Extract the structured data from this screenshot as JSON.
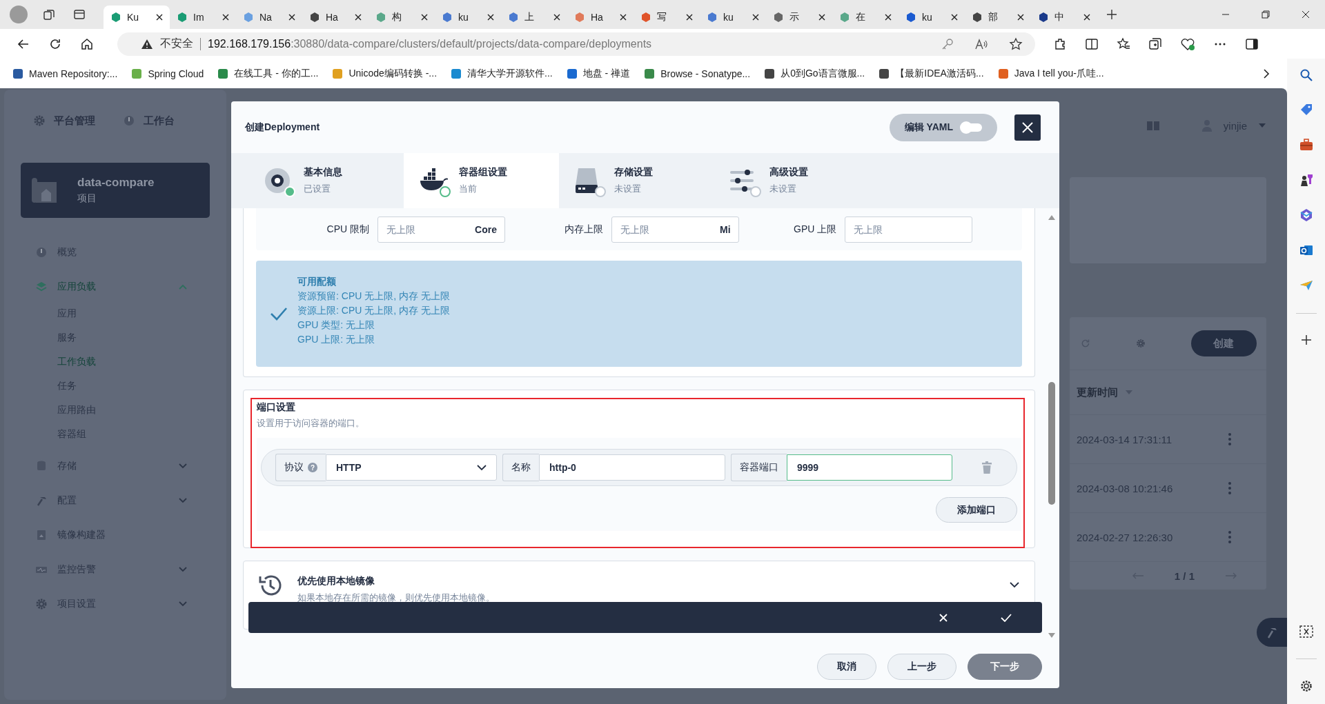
{
  "browser": {
    "tabs": [
      {
        "label": "Ku",
        "selected": true
      },
      {
        "label": "Im",
        "selected": false
      },
      {
        "label": "Na",
        "selected": false
      },
      {
        "label": "Ha",
        "selected": false
      },
      {
        "label": "构",
        "selected": false
      },
      {
        "label": "ku",
        "selected": false
      },
      {
        "label": "上",
        "selected": false
      },
      {
        "label": "Ha",
        "selected": false
      },
      {
        "label": "写",
        "selected": false
      },
      {
        "label": "ku",
        "selected": false
      },
      {
        "label": "示",
        "selected": false
      },
      {
        "label": "在",
        "selected": false
      },
      {
        "label": "ku",
        "selected": false
      },
      {
        "label": "部",
        "selected": false
      },
      {
        "label": "中",
        "selected": false
      }
    ],
    "address": {
      "security": "不安全",
      "host": "192.168.179.156",
      "path": ":30880/data-compare/clusters/default/projects/data-compare/deployments"
    },
    "bookmarks": [
      "Maven Repository:...",
      "Spring Cloud",
      "在线工具 - 你的工...",
      "Unicode编码转换 -...",
      "清华大学开源软件...",
      "地盘 - 禅道",
      "Browse - Sonatype...",
      "从0到Go语言微服...",
      "【最新IDEA激活码...",
      "Java I tell you-爪哇..."
    ]
  },
  "app": {
    "top_nav": [
      "平台管理",
      "工作台"
    ],
    "project": {
      "name": "data-compare",
      "type": "项目"
    },
    "nav": [
      {
        "label": "概览",
        "kind": "item",
        "selected": false
      },
      {
        "label": "应用负载",
        "kind": "group",
        "selected": true,
        "expanded": true,
        "children": [
          {
            "label": "应用",
            "selected": false
          },
          {
            "label": "服务",
            "selected": false
          },
          {
            "label": "工作负载",
            "selected": true
          },
          {
            "label": "任务",
            "selected": false
          },
          {
            "label": "应用路由",
            "selected": false
          },
          {
            "label": "容器组",
            "selected": false
          }
        ]
      },
      {
        "label": "存储",
        "kind": "group",
        "selected": false,
        "expanded": false
      },
      {
        "label": "配置",
        "kind": "group",
        "selected": false,
        "expanded": false
      },
      {
        "label": "镜像构建器",
        "kind": "item",
        "selected": false
      },
      {
        "label": "监控告警",
        "kind": "group",
        "selected": false,
        "expanded": false
      },
      {
        "label": "项目设置",
        "kind": "group",
        "selected": false,
        "expanded": false
      }
    ],
    "user": "yinjie",
    "create_button": "创建",
    "table": {
      "columns": [
        "更新时间"
      ],
      "rows": [
        [
          "2024-03-14 17:31:11"
        ],
        [
          "2024-03-08 10:21:46"
        ],
        [
          "2024-02-27 12:26:30"
        ]
      ]
    },
    "pagination": "1 / 1"
  },
  "modal": {
    "title": "创建Deployment",
    "yaml_toggle": {
      "label": "编辑 YAML",
      "on": false
    },
    "steps": [
      {
        "title": "基本信息",
        "status": "已设置",
        "kind": "done",
        "selected": false
      },
      {
        "title": "容器组设置",
        "status": "当前",
        "kind": "current",
        "selected": true
      },
      {
        "title": "存储设置",
        "status": "未设置",
        "kind": "todo",
        "selected": false
      },
      {
        "title": "高级设置",
        "status": "未设置",
        "kind": "todo",
        "selected": false
      }
    ],
    "limits": [
      {
        "label": "CPU 限制",
        "placeholder": "无上限",
        "unit": "Core"
      },
      {
        "label": "内存上限",
        "placeholder": "无上限",
        "unit": "Mi"
      },
      {
        "label": "GPU 上限",
        "placeholder": "无上限"
      }
    ],
    "quota": {
      "title": "可用配额",
      "lines": [
        "资源预留:  CPU 无上限, 内存 无上限",
        "资源上限:  CPU 无上限, 内存 无上限",
        "GPU 类型:  无上限",
        "GPU 上限:  无上限"
      ]
    },
    "ports": {
      "title": "端口设置",
      "description": "设置用于访问容器的端口。",
      "rows": [
        {
          "protocol_label": "协议",
          "help_mark": "?",
          "protocol": "HTTP",
          "name_label": "名称",
          "name": "http-0",
          "port_label": "容器端口",
          "port": "9999"
        }
      ],
      "add_button": "添加端口"
    },
    "local_image": {
      "title": "优先使用本地镜像",
      "description": "如果本地存在所需的镜像，则优先使用本地镜像。",
      "expanded": false
    },
    "footer": [
      {
        "label": "取消",
        "kind": "default"
      },
      {
        "label": "上一步",
        "kind": "default"
      },
      {
        "label": "下一步",
        "kind": "primary"
      }
    ]
  }
}
